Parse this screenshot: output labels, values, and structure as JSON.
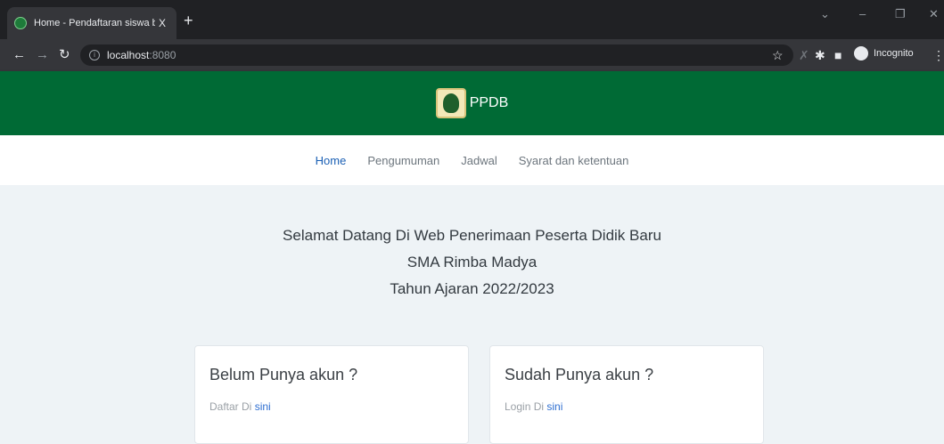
{
  "browser": {
    "tab_title": "Home - Pendaftaran siswa baru",
    "tab_close": "X",
    "new_tab": "+",
    "url_host": "localhost",
    "url_port": ":8080",
    "incognito_label": "Incognito"
  },
  "header": {
    "brand": "PPDB"
  },
  "nav": {
    "items": [
      {
        "label": "Home",
        "active": true
      },
      {
        "label": "Pengumuman"
      },
      {
        "label": "Jadwal"
      },
      {
        "label": "Syarat dan ketentuan"
      }
    ]
  },
  "welcome": {
    "line1": "Selamat Datang Di Web Penerimaan Peserta Didik Baru",
    "line2": "SMA Rimba Madya",
    "line3": "Tahun Ajaran 2022/2023"
  },
  "cards": {
    "register": {
      "title": "Belum Punya akun ?",
      "text": "Daftar Di ",
      "link": "sini"
    },
    "login": {
      "title": "Sudah Punya akun ?",
      "text": "Login Di ",
      "link": "sini"
    }
  },
  "colors": {
    "header_green": "#006a35",
    "active_link": "#1a5fb4",
    "page_bg": "#eef3f6"
  }
}
